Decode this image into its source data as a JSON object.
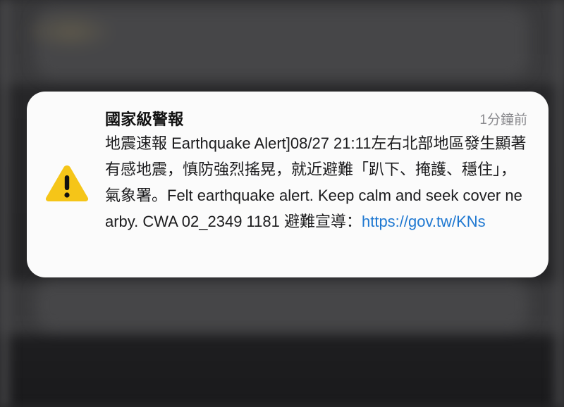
{
  "notification": {
    "title": "國家級警報",
    "time": "1分鐘前",
    "icon": "warning-triangle-icon",
    "message_text": "地震速報 Earthquake Alert]08/27 21:11左右北部地區發生顯著有感地震，慎防強烈搖晃，就近避難「趴下、掩護、穩住」，氣象署。Felt earthquake alert. Keep calm and seek cover nearby. CWA 02_2349 1181 避難宣導：",
    "link_text": "https://gov.tw/KNs"
  },
  "colors": {
    "card_background": "#fbfbfb",
    "warning_yellow": "#f5c518",
    "link_blue": "#1f78d1",
    "time_gray": "#8a8a8e"
  }
}
